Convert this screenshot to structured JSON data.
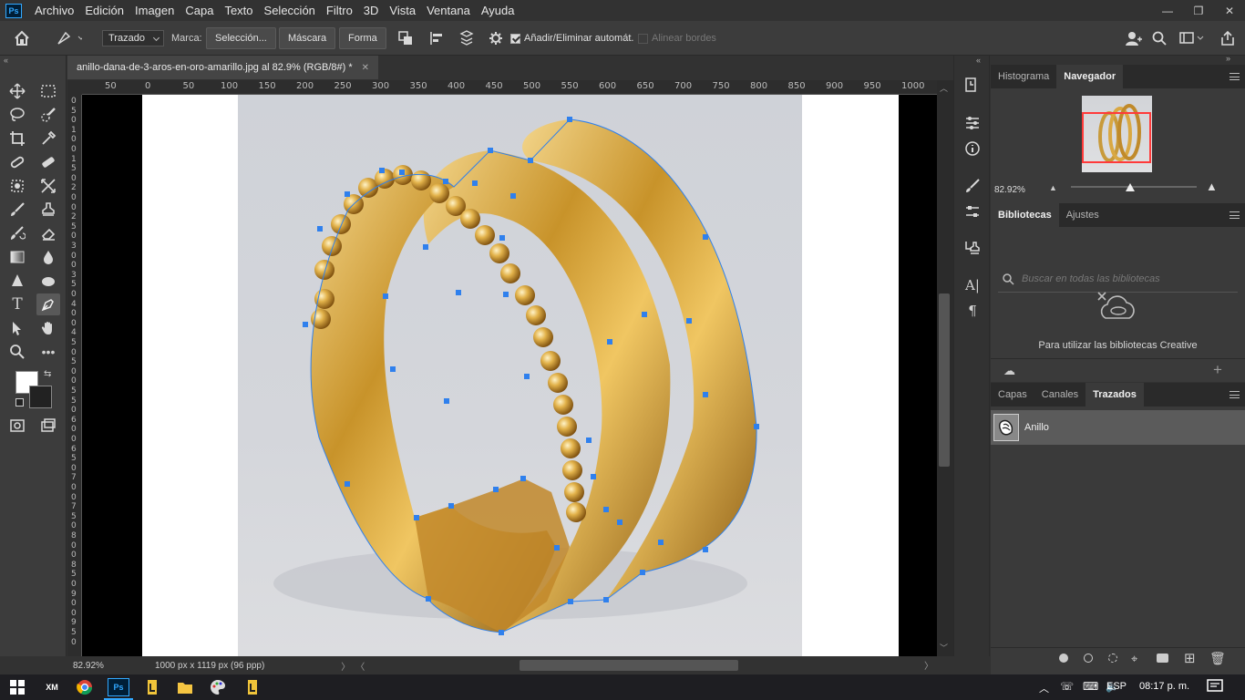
{
  "app": {
    "logo": "Ps",
    "accent": "#31a8ff"
  },
  "menu": [
    "Archivo",
    "Edición",
    "Imagen",
    "Capa",
    "Texto",
    "Selección",
    "Filtro",
    "3D",
    "Vista",
    "Ventana",
    "Ayuda"
  ],
  "window_controls": {
    "minimize": "—",
    "restore": "❐",
    "close": "✕"
  },
  "options": {
    "mode": "Trazado",
    "marca_label": "Marca:",
    "btn_seleccion": "Selección...",
    "btn_mascara": "Máscara",
    "btn_forma": "Forma",
    "auto_add_delete": "Añadir/Eliminar automát.",
    "align_edges": "Alinear bordes"
  },
  "document": {
    "tab_title": "anillo-dana-de-3-aros-en-oro-amarillo.jpg al 82.9% (RGB/8#) *",
    "close": "✕",
    "zoom": "82.92%",
    "info": "1000 px x 1119 px (96 ppp)"
  },
  "ruler": {
    "h_labels": [
      "50",
      "0",
      "50",
      "100",
      "150",
      "200",
      "250",
      "300",
      "350",
      "400",
      "450",
      "500",
      "550",
      "600",
      "650",
      "700",
      "750",
      "800",
      "850",
      "900",
      "950",
      "1000"
    ],
    "v_labels": [
      "0",
      "5",
      "0",
      "1",
      "0",
      "0",
      "1",
      "5",
      "0",
      "2",
      "0",
      "0",
      "2",
      "5",
      "0",
      "3",
      "0",
      "0",
      "3",
      "5",
      "0",
      "4",
      "0",
      "0",
      "4",
      "5",
      "0",
      "5",
      "0",
      "0",
      "5",
      "5",
      "0",
      "6",
      "0",
      "0",
      "6",
      "5",
      "0",
      "7",
      "0",
      "0",
      "7",
      "5",
      "0",
      "8",
      "0",
      "0",
      "8",
      "5",
      "0",
      "9",
      "0",
      "0",
      "9",
      "5",
      "0"
    ]
  },
  "panels": {
    "top_tabs": [
      "Histograma",
      "Navegador"
    ],
    "nav_zoom": "82.92%",
    "lib_tabs": [
      "Bibliotecas",
      "Ajustes"
    ],
    "lib_search_placeholder": "Buscar en todas las bibliotecas",
    "lib_message": "Para utilizar las bibliotecas Creative",
    "layer_tabs": [
      "Capas",
      "Canales",
      "Trazados"
    ],
    "path_name": "Anillo"
  },
  "taskbar": {
    "lang": "ESP",
    "time": "08:17 p. m."
  },
  "colors": {
    "foreground": "#ffffff",
    "background": "#222222",
    "path_anchor": "#2f80ed"
  }
}
